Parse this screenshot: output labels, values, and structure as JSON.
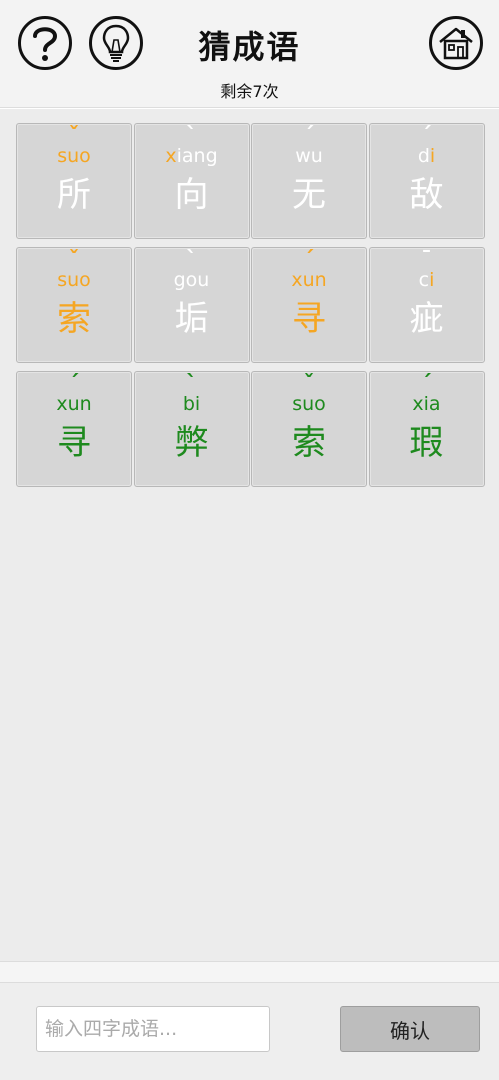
{
  "header": {
    "title": "猜成语",
    "remaining": "剩余7次",
    "icons": [
      "question-icon",
      "lightbulb-icon",
      "home-icon"
    ]
  },
  "colors": {
    "white": "#ffffff",
    "orange": "#f5a623",
    "green": "#1e8a1e",
    "tile": "#d6d6d6"
  },
  "guesses": [
    [
      {
        "tone": "ˇ",
        "pinyin": "suo",
        "hanzi": "所",
        "pinyin_color": "orange",
        "hanzi_color": "white"
      },
      {
        "tone": "ˋ",
        "pinyin": "xiang",
        "hanzi": "向",
        "pinyin_color": "mixed-x",
        "hanzi_color": "white"
      },
      {
        "tone": "ˊ",
        "pinyin": "wu",
        "hanzi": "无",
        "pinyin_color": "white",
        "hanzi_color": "white"
      },
      {
        "tone": "ˊ",
        "pinyin": "di",
        "hanzi": "敌",
        "pinyin_color": "mixed-i",
        "hanzi_color": "white"
      }
    ],
    [
      {
        "tone": "ˇ",
        "pinyin": "suo",
        "hanzi": "索",
        "pinyin_color": "orange",
        "hanzi_color": "orange"
      },
      {
        "tone": "ˋ",
        "pinyin": "gou",
        "hanzi": "垢",
        "pinyin_color": "white",
        "hanzi_color": "white"
      },
      {
        "tone": "ˊ",
        "pinyin": "xun",
        "hanzi": "寻",
        "pinyin_color": "orange",
        "hanzi_color": "orange"
      },
      {
        "tone": "ˉ",
        "pinyin": "ci",
        "hanzi": "疵",
        "pinyin_color": "mixed-i",
        "hanzi_color": "white"
      }
    ],
    [
      {
        "tone": "ˊ",
        "pinyin": "xun",
        "hanzi": "寻",
        "pinyin_color": "green",
        "hanzi_color": "green"
      },
      {
        "tone": "ˋ",
        "pinyin": "bi",
        "hanzi": "弊",
        "pinyin_color": "green",
        "hanzi_color": "green"
      },
      {
        "tone": "ˇ",
        "pinyin": "suo",
        "hanzi": "索",
        "pinyin_color": "green",
        "hanzi_color": "green"
      },
      {
        "tone": "ˊ",
        "pinyin": "xia",
        "hanzi": "瑕",
        "pinyin_color": "green",
        "hanzi_color": "green"
      }
    ]
  ],
  "input": {
    "placeholder": "输入四字成语...",
    "value": ""
  },
  "confirm_label": "确认"
}
